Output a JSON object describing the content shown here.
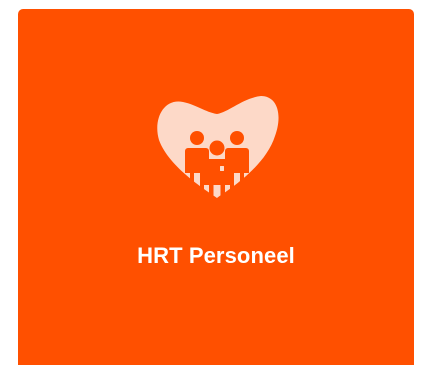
{
  "tile": {
    "label": "HRT Personeel",
    "icon": "heart-people-icon",
    "background_color": "#ff5000",
    "icon_fill_color": "#fdd9c8",
    "icon_figure_color": "#ff5000",
    "text_color": "#ffffff"
  }
}
